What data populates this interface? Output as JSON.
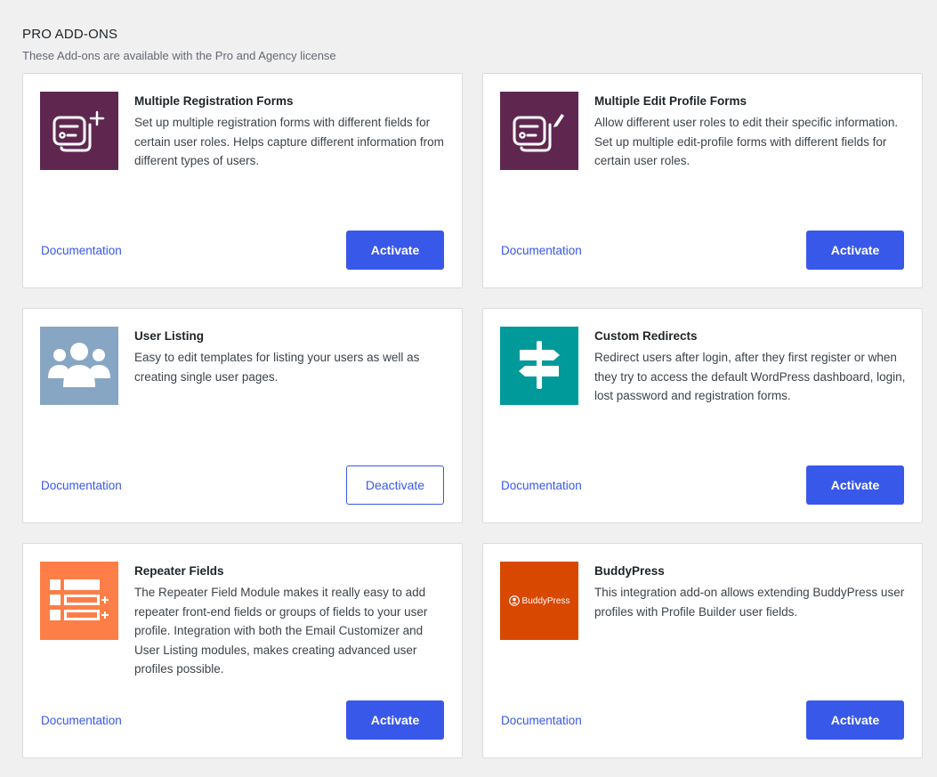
{
  "section": {
    "title": "PRO ADD-ONS",
    "subtitle": "These Add-ons are available with the Pro and Agency license"
  },
  "colors": {
    "accent": "#3858e9",
    "multiple_registration_bg": "#5f2750",
    "multiple_edit_bg": "#5f2750",
    "user_listing_bg": "#87a6c4",
    "custom_redirects_bg": "#009a9b",
    "repeater_fields_bg": "#fd7e47",
    "buddypress_bg": "#d84800"
  },
  "addons": [
    {
      "title": "Multiple Registration Forms",
      "description": "Set up multiple registration forms with different fields for certain user roles. Helps capture different information from different types of users.",
      "icon": "form-plus-icon",
      "doc_label": "Documentation",
      "button_label": "Activate",
      "state": "inactive"
    },
    {
      "title": "Multiple Edit Profile Forms",
      "description": "Allow different user roles to edit their specific information. Set up multiple edit-profile forms with different fields for certain user roles.",
      "icon": "form-pencil-icon",
      "doc_label": "Documentation",
      "button_label": "Activate",
      "state": "inactive"
    },
    {
      "title": "User Listing",
      "description": "Easy to edit templates for listing your users as well as creating single user pages.",
      "icon": "users-group-icon",
      "doc_label": "Documentation",
      "button_label": "Deactivate",
      "state": "active"
    },
    {
      "title": "Custom Redirects",
      "description": "Redirect users after login, after they first register or when they try to access the default WordPress dashboard, login, lost password and registration forms.",
      "icon": "signpost-icon",
      "doc_label": "Documentation",
      "button_label": "Activate",
      "state": "inactive"
    },
    {
      "title": "Repeater Fields",
      "description": "The Repeater Field Module makes it really easy to add repeater front-end fields or groups of fields to your user profile. Integration with both the Email Customizer and User Listing modules, makes creating advanced user profiles possible.",
      "icon": "repeater-list-icon",
      "doc_label": "Documentation",
      "button_label": "Activate",
      "state": "inactive"
    },
    {
      "title": "BuddyPress",
      "description": "This integration add-on allows extending BuddyPress user profiles with Profile Builder user fields.",
      "icon": "buddypress-logo",
      "logo_text": "BuddyPress",
      "doc_label": "Documentation",
      "button_label": "Activate",
      "state": "inactive"
    }
  ]
}
